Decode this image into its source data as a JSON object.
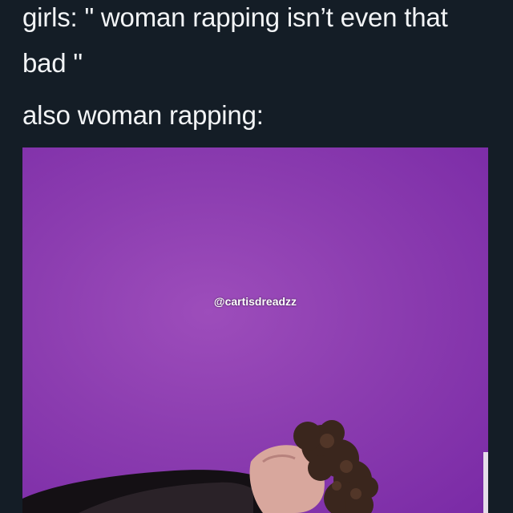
{
  "post": {
    "text_line1": "girls: \" woman rapping isn’t even that",
    "text_line2": "bad \"",
    "text_line3": "also woman rapping:"
  },
  "media": {
    "watermark": "@cartisdreadzz",
    "background_color": "#8c3db0"
  }
}
